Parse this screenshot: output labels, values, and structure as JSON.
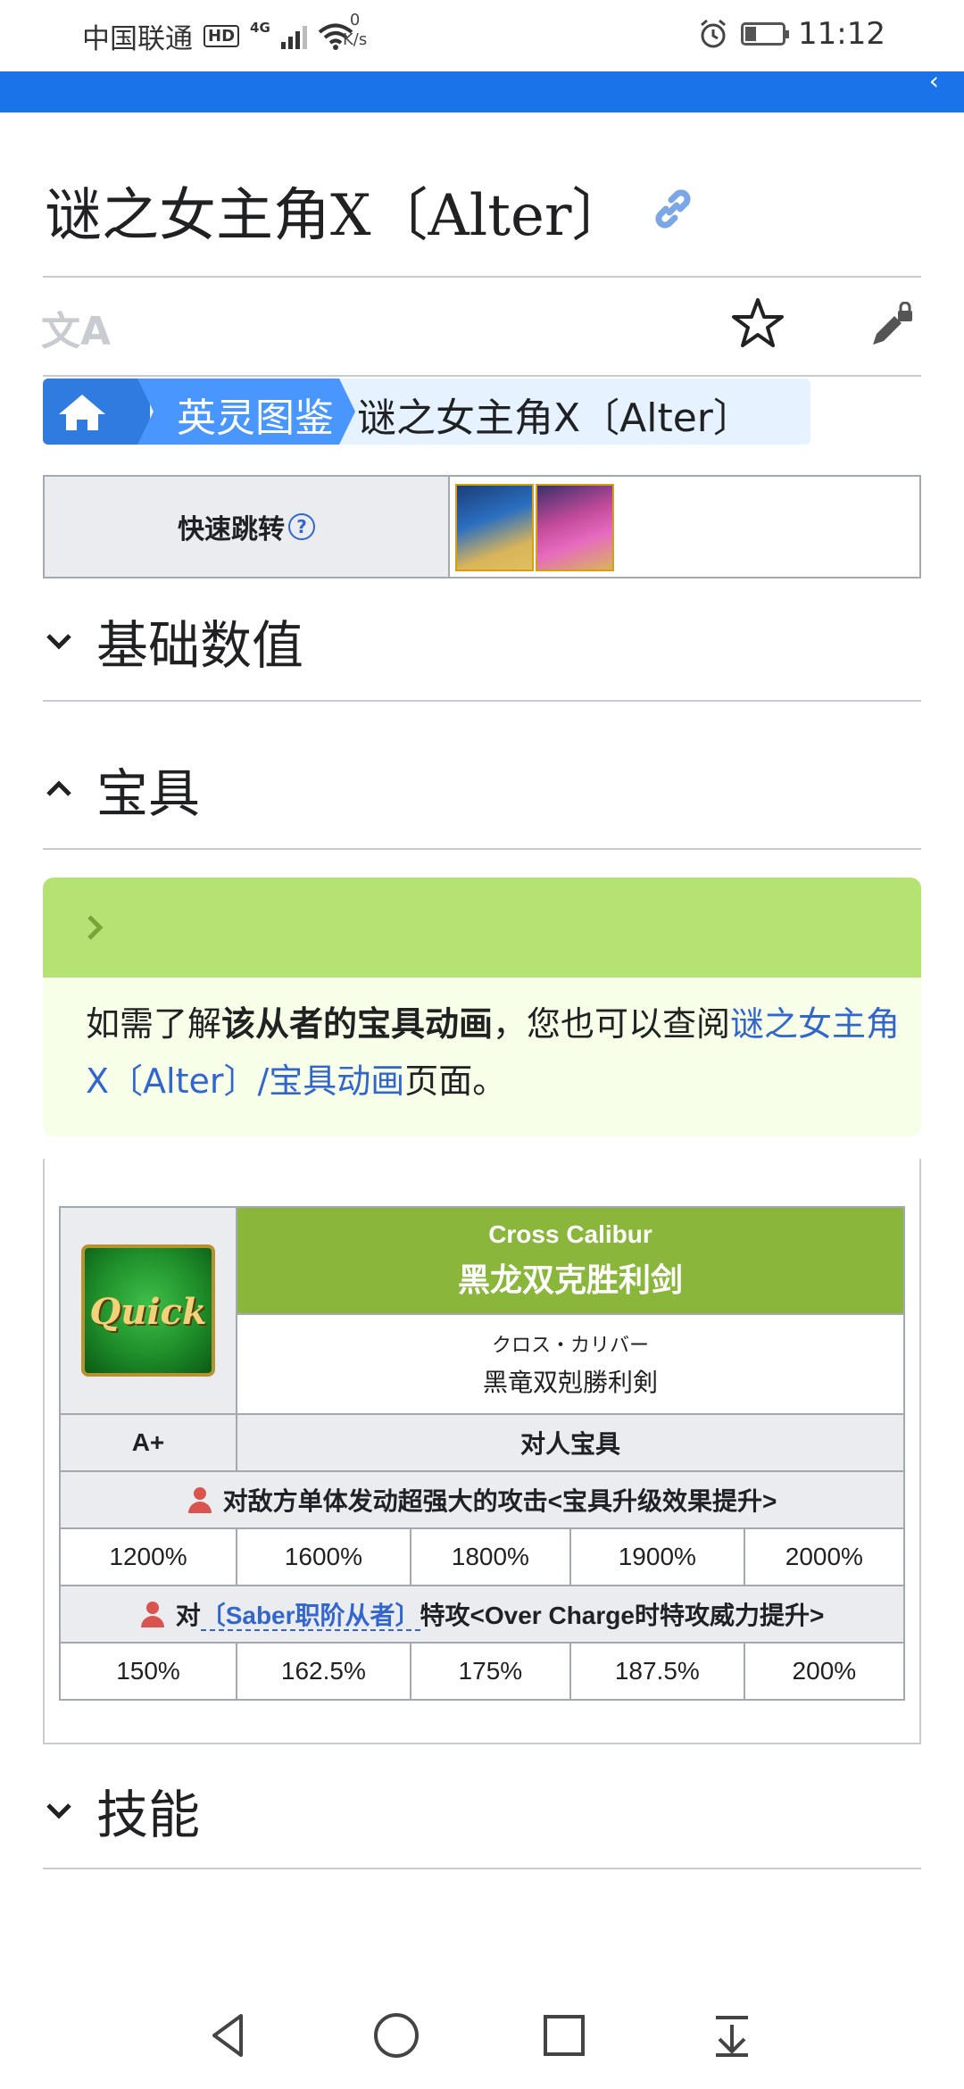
{
  "status": {
    "carrier": "中国联通",
    "hd": "HD",
    "net": "4G",
    "speed_value": "0",
    "speed_unit": "K/s",
    "time": "11:12",
    "battery_level": 0.3
  },
  "page": {
    "title": "谜之女主角X〔Alter〕",
    "lang_icon": "translate-icon",
    "breadcrumb": {
      "home_icon": "home-icon",
      "section": "英灵图鉴",
      "current": "谜之女主角X〔Alter〕"
    },
    "quick_jump": {
      "label": "快速跳转",
      "help": "?"
    }
  },
  "sections": {
    "basic": "基础数值",
    "np": "宝具",
    "skills": "技能"
  },
  "notice": {
    "prefix": "如需了解",
    "bold": "该从者的宝具动画",
    "middle": "，您也可以查阅",
    "link": "谜之女主角X〔Alter〕/宝具动画",
    "suffix": "页面。"
  },
  "noble_phantasm": {
    "card_label": "Quick",
    "name_en": "Cross Calibur",
    "name_cn": "黑龙双克胜利剑",
    "ruby_jp": "クロス・カリバー",
    "name_jp": "黑竜双剋勝利剣",
    "rank": "A+",
    "type": "对人宝具",
    "effect1": "对敌方单体发动超强大的攻击<宝具升级效果提升>",
    "values1": [
      "1200%",
      "1600%",
      "1800%",
      "1900%",
      "2000%"
    ],
    "effect2_prefix": "对",
    "effect2_link": "〔Saber职阶从者〕",
    "effect2_suffix": "特攻<Over Charge时特攻威力提升>",
    "values2": [
      "150%",
      "162.5%",
      "175%",
      "187.5%",
      "200%"
    ]
  }
}
